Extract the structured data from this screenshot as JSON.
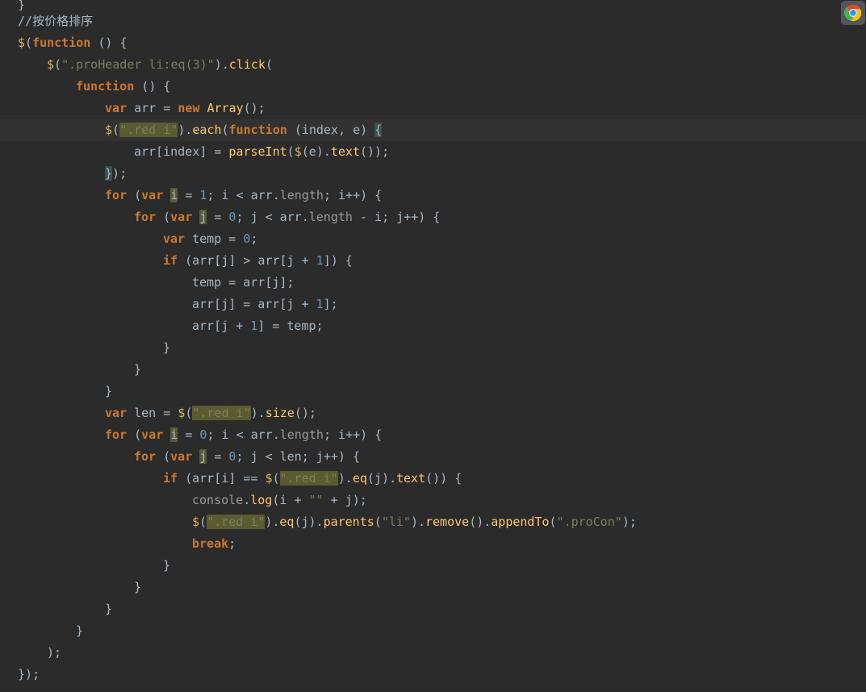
{
  "app": {
    "type": "code-editor",
    "theme": "darcula",
    "background_color": "#2b2b2b",
    "current_line_color": "#323232",
    "search_highlight_color": "#5b5b30",
    "brace_match_color": "#3b514d",
    "font_size_px": 15,
    "line_height_px": 27
  },
  "tray": {
    "chrome_icon": "chrome-browser-icon",
    "badge_background": "#53565c"
  },
  "editor": {
    "search_term": ".red i",
    "current_line_number": 5,
    "lines": [
      {
        "n": 0,
        "indent": 1,
        "clipped": true,
        "text": "}"
      },
      {
        "n": 1,
        "indent": 1,
        "text": "//按价格排序"
      },
      {
        "n": 2,
        "indent": 1,
        "text": "$(function () {"
      },
      {
        "n": 3,
        "indent": 2,
        "text": "$(\".proHeader li:eq(3)\").click("
      },
      {
        "n": 4,
        "indent": 3,
        "text": "function () {"
      },
      {
        "n": 5,
        "indent": 4,
        "text": "var arr = new Array();"
      },
      {
        "n": 6,
        "indent": 4,
        "text": "$(\".red i\").each(function (index, e) {",
        "current": true
      },
      {
        "n": 7,
        "indent": 5,
        "text": "arr[index] = parseInt($(e).text());"
      },
      {
        "n": 8,
        "indent": 4,
        "text": "});"
      },
      {
        "n": 9,
        "indent": 4,
        "text": "for (var i = 1; i < arr.length; i++) {"
      },
      {
        "n": 10,
        "indent": 5,
        "text": "for (var j = 0; j < arr.length - i; j++) {"
      },
      {
        "n": 11,
        "indent": 6,
        "text": "var temp = 0;"
      },
      {
        "n": 12,
        "indent": 6,
        "text": "if (arr[j] > arr[j + 1]) {"
      },
      {
        "n": 13,
        "indent": 7,
        "text": "temp = arr[j];"
      },
      {
        "n": 14,
        "indent": 7,
        "text": "arr[j] = arr[j + 1];"
      },
      {
        "n": 15,
        "indent": 7,
        "text": "arr[j + 1] = temp;"
      },
      {
        "n": 16,
        "indent": 6,
        "text": "}"
      },
      {
        "n": 17,
        "indent": 5,
        "text": "}"
      },
      {
        "n": 18,
        "indent": 4,
        "text": "}"
      },
      {
        "n": 19,
        "indent": 4,
        "text": "var len = $(\".red i\").size();"
      },
      {
        "n": 20,
        "indent": 4,
        "text": "for (var i = 0; i < arr.length; i++) {"
      },
      {
        "n": 21,
        "indent": 5,
        "text": "for (var j = 0; j < len; j++) {"
      },
      {
        "n": 22,
        "indent": 6,
        "text": "if (arr[i] == $(\".red i\").eq(j).text()) {"
      },
      {
        "n": 23,
        "indent": 7,
        "text": "console.log(i + \"\" + j);"
      },
      {
        "n": 24,
        "indent": 7,
        "text": "$(\".red i\").eq(j).parents(\"li\").remove().appendTo(\".proCon\");"
      },
      {
        "n": 25,
        "indent": 7,
        "text": "break;"
      },
      {
        "n": 26,
        "indent": 6,
        "text": "}"
      },
      {
        "n": 27,
        "indent": 5,
        "text": "}"
      },
      {
        "n": 28,
        "indent": 4,
        "text": "}"
      },
      {
        "n": 29,
        "indent": 3,
        "text": "}"
      },
      {
        "n": 30,
        "indent": 2,
        "text": ");"
      },
      {
        "n": 31,
        "indent": 1,
        "text": "});"
      }
    ]
  }
}
